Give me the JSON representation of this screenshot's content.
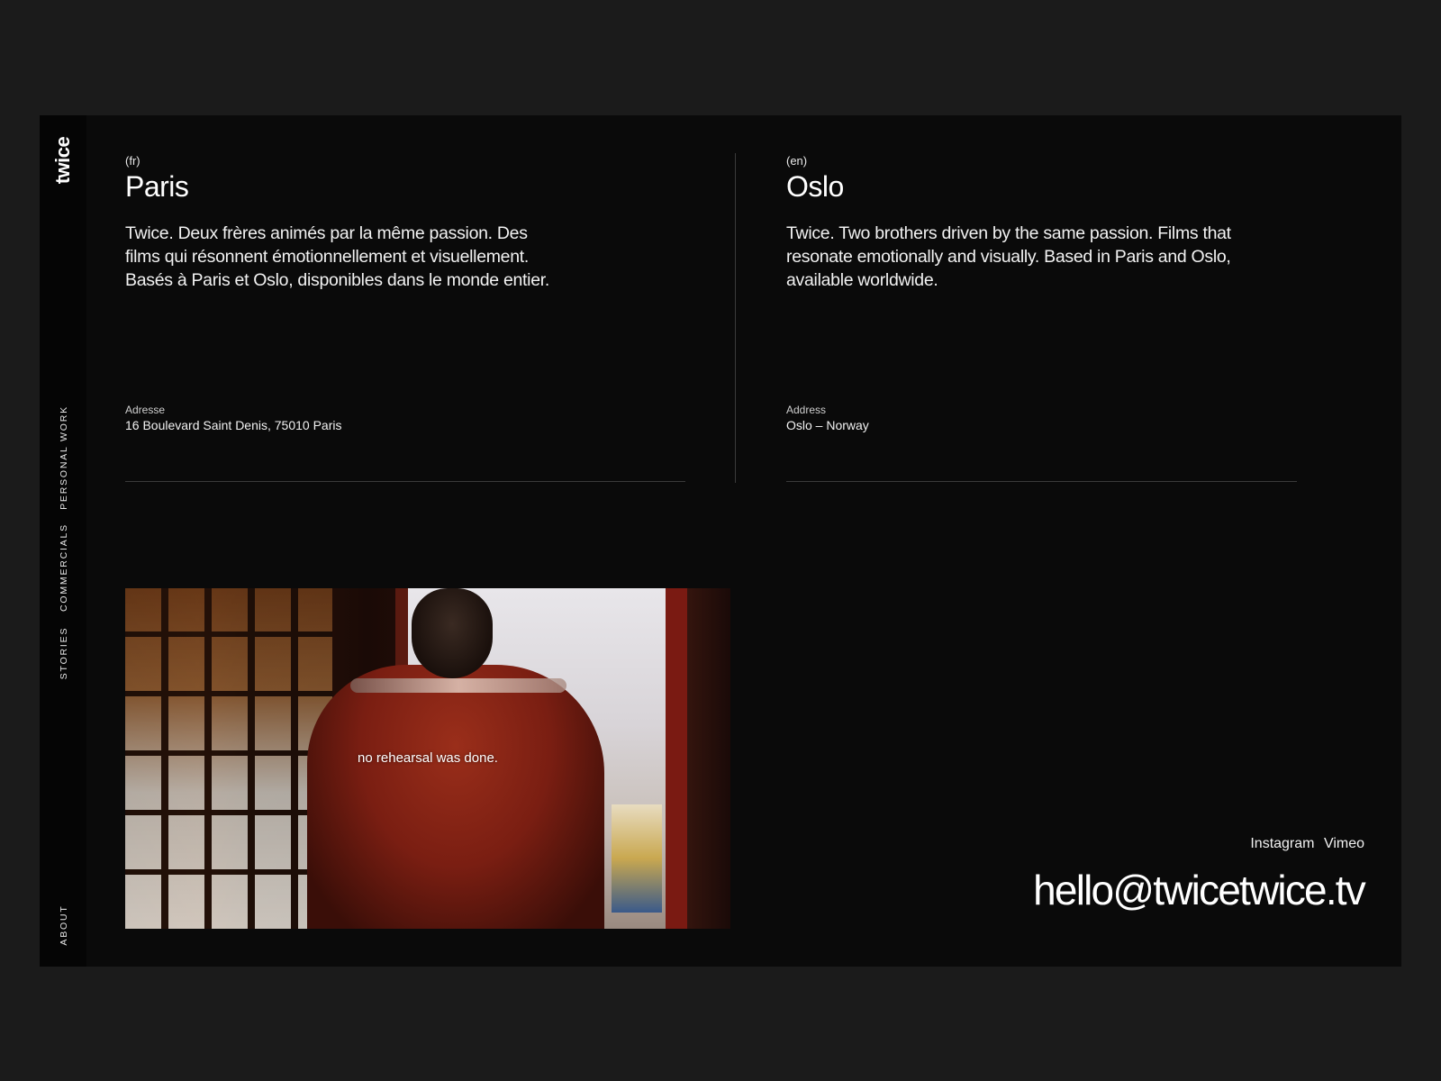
{
  "brand": {
    "logo": "twice"
  },
  "nav": {
    "personal_work": "PERSONAL WORK",
    "commercials": "COMMERCIALS",
    "stories": "STORIES",
    "about": "ABOUT"
  },
  "locations": {
    "fr": {
      "lang": "(fr)",
      "city": "Paris",
      "description": "Twice. Deux frères animés par la même passion. Des films qui résonnent émotionnellement et visuellement. Basés à Paris et Oslo, disponibles dans le monde entier.",
      "address_label": "Adresse",
      "address_value": "16 Boulevard Saint Denis, 75010 Paris"
    },
    "en": {
      "lang": "(en)",
      "city": "Oslo",
      "description": "Twice. Two brothers driven by the same passion. Films that resonate emotionally and visually. Based in Paris and Oslo, available worldwide.",
      "address_label": "Address",
      "address_value": "Oslo – Norway"
    }
  },
  "video": {
    "caption": "no rehearsal was done."
  },
  "contact": {
    "instagram": "Instagram",
    "vimeo": "Vimeo",
    "email": "hello@twicetwice.tv"
  }
}
